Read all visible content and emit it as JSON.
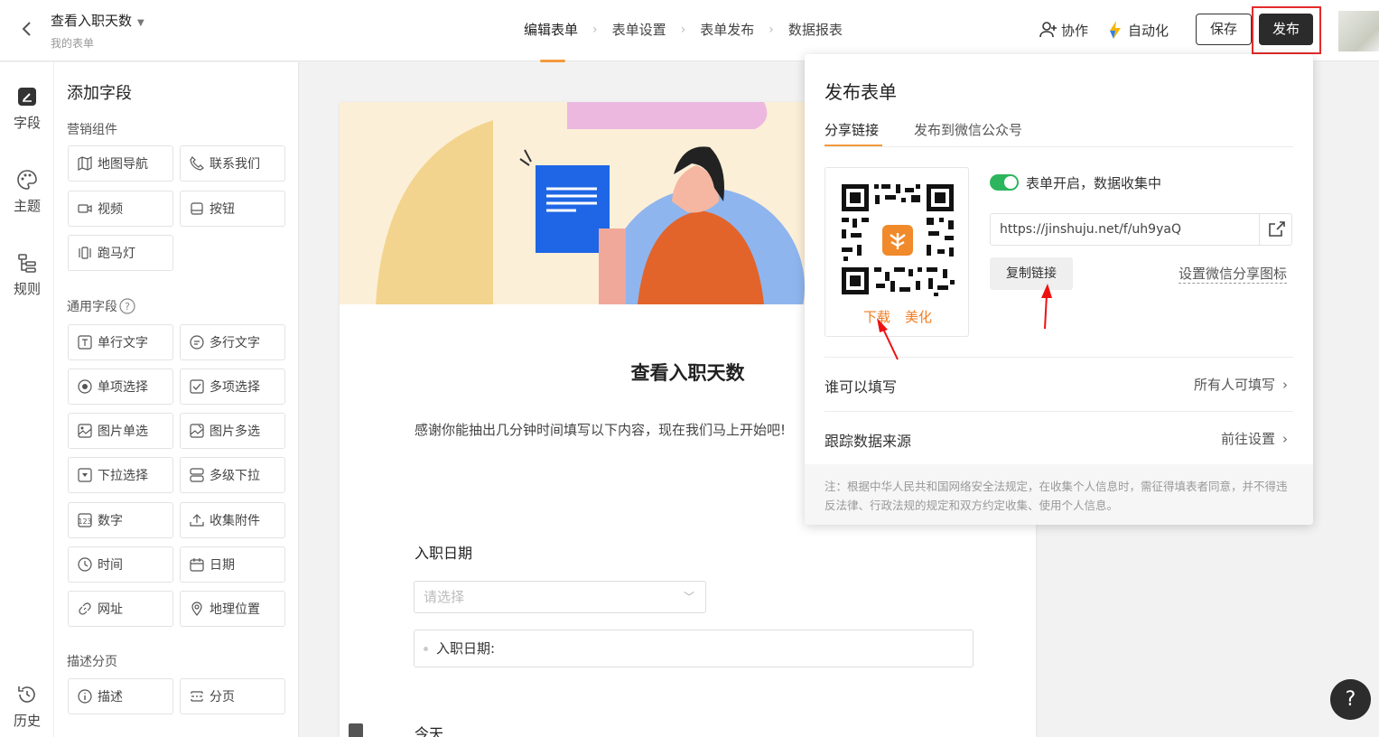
{
  "header": {
    "form_title": "查看入职天数",
    "form_subtitle": "我的表单",
    "steps": [
      "编辑表单",
      "表单设置",
      "表单发布",
      "数据报表"
    ],
    "collaborate_label": "协作",
    "automation_label": "自动化",
    "save_label": "保存",
    "publish_label": "发布"
  },
  "rail": {
    "items": [
      {
        "label": "字段",
        "icon": "edit-icon"
      },
      {
        "label": "主题",
        "icon": "palette-icon"
      },
      {
        "label": "规则",
        "icon": "rules-icon"
      },
      {
        "label": "历史",
        "icon": "history-icon"
      }
    ]
  },
  "fields_panel": {
    "title": "添加字段",
    "marketing_title": "营销组件",
    "marketing": [
      "地图导航",
      "联系我们",
      "视频",
      "按钮",
      "跑马灯"
    ],
    "common_title": "通用字段",
    "common": [
      "单行文字",
      "多行文字",
      "单项选择",
      "多项选择",
      "图片单选",
      "图片多选",
      "下拉选择",
      "多级下拉",
      "数字",
      "收集附件",
      "时间",
      "日期",
      "网址",
      "地理位置"
    ],
    "desc_title": "描述分页",
    "desc": [
      "描述",
      "分页"
    ]
  },
  "canvas": {
    "title": "查看入职天数",
    "description": "感谢你能抽出几分钟时间填写以下内容，现在我们马上开始吧!",
    "q1_label": "入职日期",
    "q1_placeholder": "请选择",
    "calc_field": "入职日期:",
    "q2_label": "今天"
  },
  "publish_popover": {
    "title": "发布表单",
    "tabs": [
      "分享链接",
      "发布到微信公众号"
    ],
    "qr_download": "下载",
    "qr_beautify": "美化",
    "status": "表单开启，数据收集中",
    "url": "https://jinshuju.net/f/uh9yaQ",
    "copy_label": "复制链接",
    "wechat_icon_label": "设置微信分享图标",
    "who_can_fill_label": "谁可以填写",
    "who_can_fill_value": "所有人可填写",
    "track_label": "跟踪数据来源",
    "track_value": "前往设置",
    "notice": "注：根据中华人民共和国网络安全法规定，在收集个人信息时，需征得填表者同意，并不得违反法律、行政法规的规定和双方约定收集、使用个人信息。"
  },
  "colors": {
    "accent": "#f39a3c",
    "highlight": "#e42b2b",
    "toggle_on": "#2db55d",
    "qr_action": "#f07d22"
  }
}
